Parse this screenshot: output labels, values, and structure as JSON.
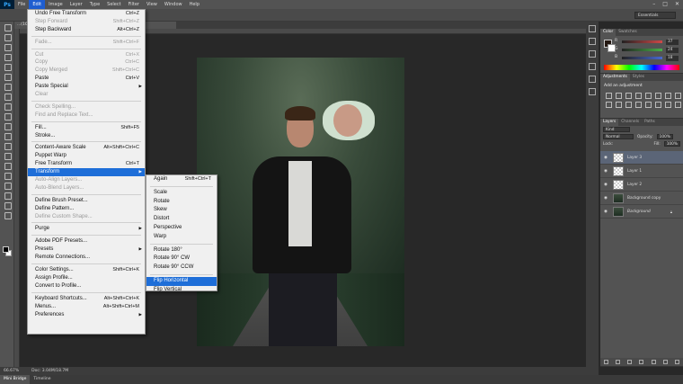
{
  "menubar": {
    "logo": "Ps",
    "items": [
      "File",
      "Edit",
      "Image",
      "Layer",
      "Type",
      "Select",
      "Filter",
      "View",
      "Window",
      "Help"
    ],
    "active": "Edit",
    "window_controls": [
      "–",
      "□",
      "✕"
    ]
  },
  "optionsbar": {
    "workspace": "Essentials"
  },
  "document": {
    "tab_title": "...(10.jpg @ 66.7% (RGB/8)...",
    "zoom": "66.67%",
    "doc_info": "Doc: 3.04M/18.7M"
  },
  "edit_menu": {
    "groups": [
      [
        {
          "label": "Undo Free Transform",
          "shortcut": "Ctrl+Z",
          "disabled": false
        },
        {
          "label": "Step Forward",
          "shortcut": "Shift+Ctrl+Z",
          "disabled": true
        },
        {
          "label": "Step Backward",
          "shortcut": "Alt+Ctrl+Z",
          "disabled": false
        }
      ],
      [
        {
          "label": "Fade...",
          "shortcut": "Shift+Ctrl+F",
          "disabled": true
        }
      ],
      [
        {
          "label": "Cut",
          "shortcut": "Ctrl+X",
          "disabled": true
        },
        {
          "label": "Copy",
          "shortcut": "Ctrl+C",
          "disabled": true
        },
        {
          "label": "Copy Merged",
          "shortcut": "Shift+Ctrl+C",
          "disabled": true
        },
        {
          "label": "Paste",
          "shortcut": "Ctrl+V",
          "disabled": false
        },
        {
          "label": "Paste Special",
          "shortcut": "",
          "submenu": true,
          "disabled": false
        },
        {
          "label": "Clear",
          "shortcut": "",
          "disabled": true
        }
      ],
      [
        {
          "label": "Check Spelling...",
          "shortcut": "",
          "disabled": true
        },
        {
          "label": "Find and Replace Text...",
          "shortcut": "",
          "disabled": true
        }
      ],
      [
        {
          "label": "Fill...",
          "shortcut": "Shift+F5",
          "disabled": false
        },
        {
          "label": "Stroke...",
          "shortcut": "",
          "disabled": false
        }
      ],
      [
        {
          "label": "Content-Aware Scale",
          "shortcut": "Alt+Shift+Ctrl+C",
          "disabled": false
        },
        {
          "label": "Puppet Warp",
          "shortcut": "",
          "disabled": false
        },
        {
          "label": "Free Transform",
          "shortcut": "Ctrl+T",
          "disabled": false
        },
        {
          "label": "Transform",
          "shortcut": "",
          "submenu": true,
          "highlighted": true,
          "disabled": false
        },
        {
          "label": "Auto-Align Layers...",
          "shortcut": "",
          "disabled": true
        },
        {
          "label": "Auto-Blend Layers...",
          "shortcut": "",
          "disabled": true
        }
      ],
      [
        {
          "label": "Define Brush Preset...",
          "shortcut": "",
          "disabled": false
        },
        {
          "label": "Define Pattern...",
          "shortcut": "",
          "disabled": false
        },
        {
          "label": "Define Custom Shape...",
          "shortcut": "",
          "disabled": true
        }
      ],
      [
        {
          "label": "Purge",
          "shortcut": "",
          "submenu": true,
          "disabled": false
        }
      ],
      [
        {
          "label": "Adobe PDF Presets...",
          "shortcut": "",
          "disabled": false
        },
        {
          "label": "Presets",
          "shortcut": "",
          "submenu": true,
          "disabled": false
        },
        {
          "label": "Remote Connections...",
          "shortcut": "",
          "disabled": false
        }
      ],
      [
        {
          "label": "Color Settings...",
          "shortcut": "Shift+Ctrl+K",
          "disabled": false
        },
        {
          "label": "Assign Profile...",
          "shortcut": "",
          "disabled": false
        },
        {
          "label": "Convert to Profile...",
          "shortcut": "",
          "disabled": false
        }
      ],
      [
        {
          "label": "Keyboard Shortcuts...",
          "shortcut": "Alt+Shift+Ctrl+K",
          "disabled": false
        },
        {
          "label": "Menus...",
          "shortcut": "Alt+Shift+Ctrl+M",
          "disabled": false
        },
        {
          "label": "Preferences",
          "shortcut": "",
          "submenu": true,
          "disabled": false
        }
      ]
    ]
  },
  "transform_submenu": {
    "groups": [
      [
        {
          "label": "Again",
          "shortcut": "Shift+Ctrl+T"
        }
      ],
      [
        {
          "label": "Scale",
          "shortcut": ""
        },
        {
          "label": "Rotate",
          "shortcut": ""
        },
        {
          "label": "Skew",
          "shortcut": ""
        },
        {
          "label": "Distort",
          "shortcut": ""
        },
        {
          "label": "Perspective",
          "shortcut": ""
        },
        {
          "label": "Warp",
          "shortcut": ""
        }
      ],
      [
        {
          "label": "Rotate 180°",
          "shortcut": ""
        },
        {
          "label": "Rotate 90° CW",
          "shortcut": ""
        },
        {
          "label": "Rotate 90° CCW",
          "shortcut": ""
        }
      ],
      [
        {
          "label": "Flip Horizontal",
          "shortcut": "",
          "highlighted": true
        },
        {
          "label": "Flip Vertical",
          "shortcut": ""
        }
      ]
    ]
  },
  "color_panel": {
    "tabs": [
      "Color",
      "Swatches"
    ],
    "channels": [
      {
        "label": "R",
        "value": "37",
        "color": "#d04848"
      },
      {
        "label": "G",
        "value": "24",
        "color": "#48b048"
      },
      {
        "label": "B",
        "value": "18",
        "color": "#4868d0"
      }
    ]
  },
  "adjustments_panel": {
    "tabs": [
      "Adjustments",
      "Styles"
    ],
    "title": "Add an adjustment"
  },
  "layers_panel": {
    "tabs": [
      "Layers",
      "Channels",
      "Paths"
    ],
    "kind": "Kind",
    "blend_mode": "Normal",
    "opacity_label": "Opacity:",
    "opacity": "100%",
    "lock_label": "Lock:",
    "fill_label": "Fill:",
    "fill": "100%",
    "layers": [
      {
        "name": "Layer 3",
        "selected": true,
        "thumb": "transparent",
        "locked": false
      },
      {
        "name": "Layer 1",
        "selected": false,
        "thumb": "transparent",
        "locked": false
      },
      {
        "name": "Layer 2",
        "selected": false,
        "thumb": "transparent",
        "locked": false
      },
      {
        "name": "Background copy",
        "selected": false,
        "thumb": "photo",
        "locked": false
      },
      {
        "name": "Background",
        "selected": false,
        "thumb": "photo",
        "locked": true
      }
    ]
  },
  "bottom_tabs": [
    "Mini Bridge",
    "Timeline"
  ]
}
